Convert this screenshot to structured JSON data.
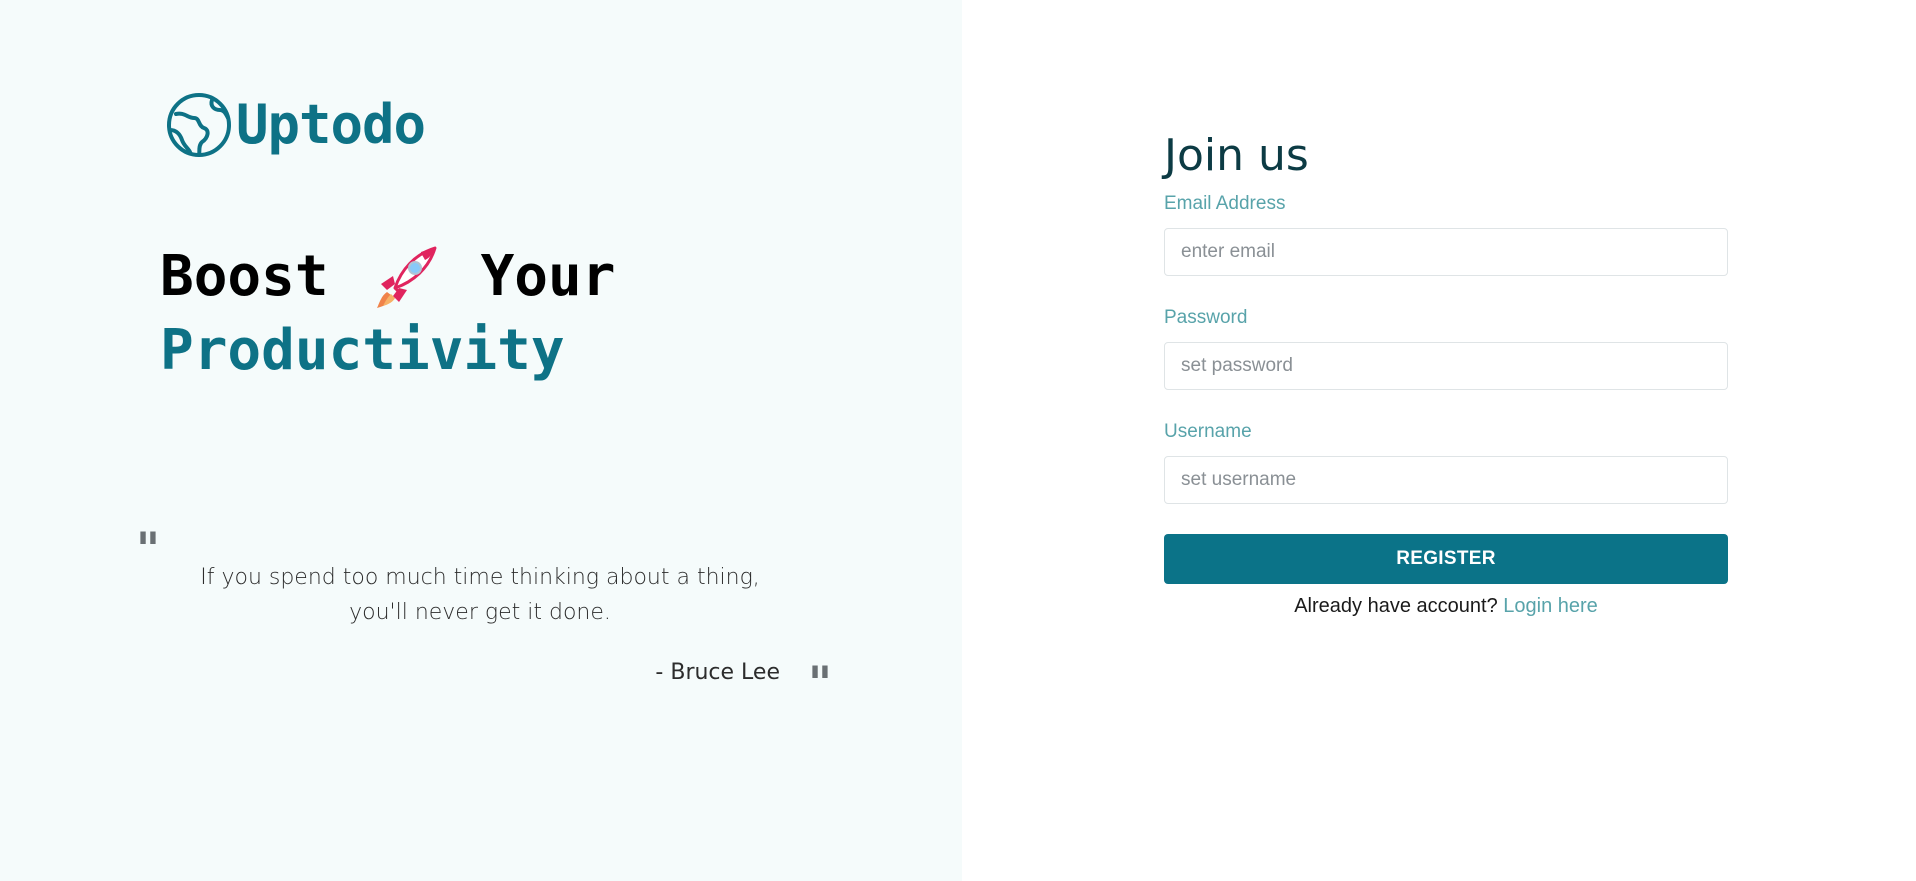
{
  "brand": {
    "logo_icon": "globe-icon",
    "name": "Uptodo",
    "color": "#0e7286"
  },
  "headline": {
    "word1": "Boost",
    "emoji_icon": "rocket-icon",
    "word2": "Your",
    "accent_word": "Productivity"
  },
  "quote": {
    "open_mark": "\"",
    "close_mark": "\"",
    "text": "If you spend too much time thinking about a thing, you'll never get it done.",
    "author": "- Bruce Lee"
  },
  "form": {
    "title": "Join us",
    "fields": [
      {
        "label": "Email Address",
        "placeholder": "enter email",
        "value": ""
      },
      {
        "label": "Password",
        "placeholder": "set password",
        "value": ""
      },
      {
        "label": "Username",
        "placeholder": "set username",
        "value": ""
      }
    ],
    "submit_label": "REGISTER",
    "footer_text": "Already have account?",
    "footer_link": "Login here"
  },
  "colors": {
    "accent": "#0b7388",
    "label": "#58a3aa",
    "left_background": "#f5fbfb"
  }
}
